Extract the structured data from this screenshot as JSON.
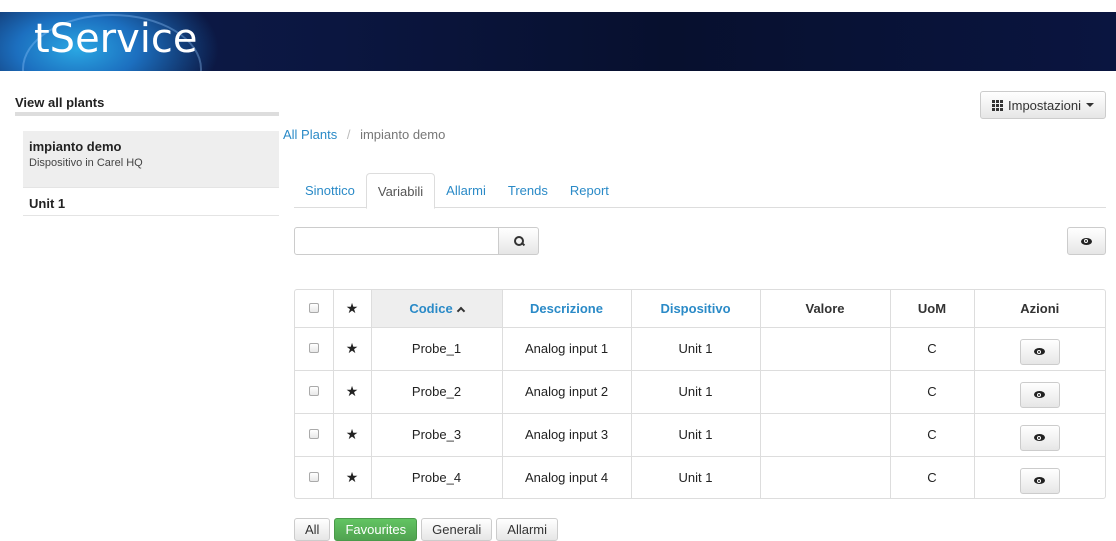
{
  "header": {
    "logo_text": "tService"
  },
  "sidebar": {
    "title": "View all plants",
    "plant": {
      "name": "impianto demo",
      "description": "Dispositivo in Carel HQ"
    },
    "unit": "Unit 1"
  },
  "settings": {
    "label": "Impostazioni"
  },
  "breadcrumb": {
    "root": "All Plants",
    "separator": "/",
    "current": "impianto demo"
  },
  "tabs": [
    {
      "label": "Sinottico",
      "active": false
    },
    {
      "label": "Variabili",
      "active": true
    },
    {
      "label": "Allarmi",
      "active": false
    },
    {
      "label": "Trends",
      "active": false
    },
    {
      "label": "Report",
      "active": false
    }
  ],
  "search": {
    "value": "",
    "placeholder": ""
  },
  "table": {
    "columns": [
      "",
      "★",
      "Codice",
      "Descrizione",
      "Dispositivo",
      "Valore",
      "UoM",
      "Azioni"
    ],
    "rows": [
      {
        "star": "★",
        "code": "Probe_1",
        "description": "Analog input 1",
        "device": "Unit 1",
        "value": "",
        "uom": "C"
      },
      {
        "star": "★",
        "code": "Probe_2",
        "description": "Analog input 2",
        "device": "Unit 1",
        "value": "",
        "uom": "C"
      },
      {
        "star": "★",
        "code": "Probe_3",
        "description": "Analog input 3",
        "device": "Unit 1",
        "value": "",
        "uom": "C"
      },
      {
        "star": "★",
        "code": "Probe_4",
        "description": "Analog input 4",
        "device": "Unit 1",
        "value": "",
        "uom": "C"
      }
    ]
  },
  "filters": [
    {
      "label": "All",
      "active": false
    },
    {
      "label": "Favourites",
      "active": true
    },
    {
      "label": "Generali",
      "active": false
    },
    {
      "label": "Allarmi",
      "active": false
    }
  ],
  "colors": {
    "link": "#2a8ac7",
    "active_filter": "#5cb85c",
    "banner": "#0b1640"
  }
}
